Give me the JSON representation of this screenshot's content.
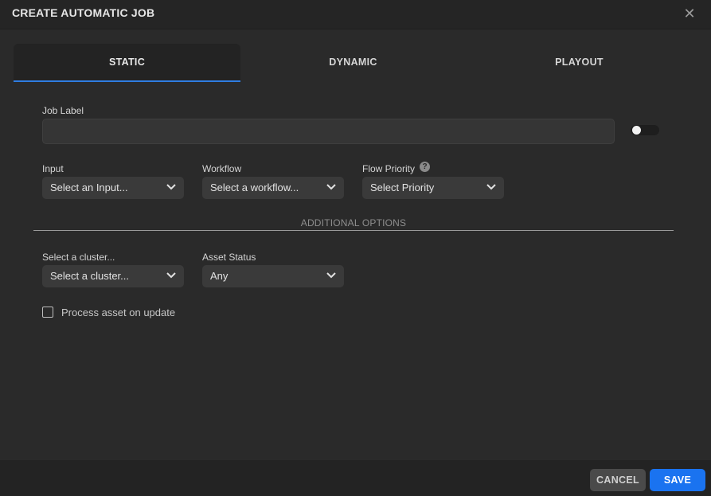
{
  "dialog": {
    "title": "CREATE AUTOMATIC JOB",
    "close_glyph": "✕"
  },
  "tabs": [
    {
      "label": "STATIC",
      "active": true
    },
    {
      "label": "DYNAMIC",
      "active": false
    },
    {
      "label": "PLAYOUT",
      "active": false
    }
  ],
  "job_label": {
    "label": "Job Label",
    "value": "",
    "toggle_on": false
  },
  "input": {
    "label": "Input",
    "value": "Select an Input..."
  },
  "workflow": {
    "label": "Workflow",
    "value": "Select a workflow..."
  },
  "flow_priority": {
    "label": "Flow Priority",
    "value": "Select Priority",
    "help_glyph": "?"
  },
  "additional_options": {
    "title": "ADDITIONAL OPTIONS"
  },
  "cluster": {
    "label": "Select a cluster...",
    "value": "Select a cluster..."
  },
  "asset_status": {
    "label": "Asset Status",
    "value": "Any"
  },
  "process_on_update": {
    "label": "Process asset on update",
    "checked": false
  },
  "footer": {
    "cancel_label": "CANCEL",
    "save_label": "SAVE"
  },
  "colors": {
    "accent": "#1a73f0",
    "tab_underline": "#2f7de1",
    "background": "#2a2a2a"
  },
  "icons": {
    "close": "close-icon",
    "chevron": "chevron-down-icon",
    "help": "help-icon"
  }
}
